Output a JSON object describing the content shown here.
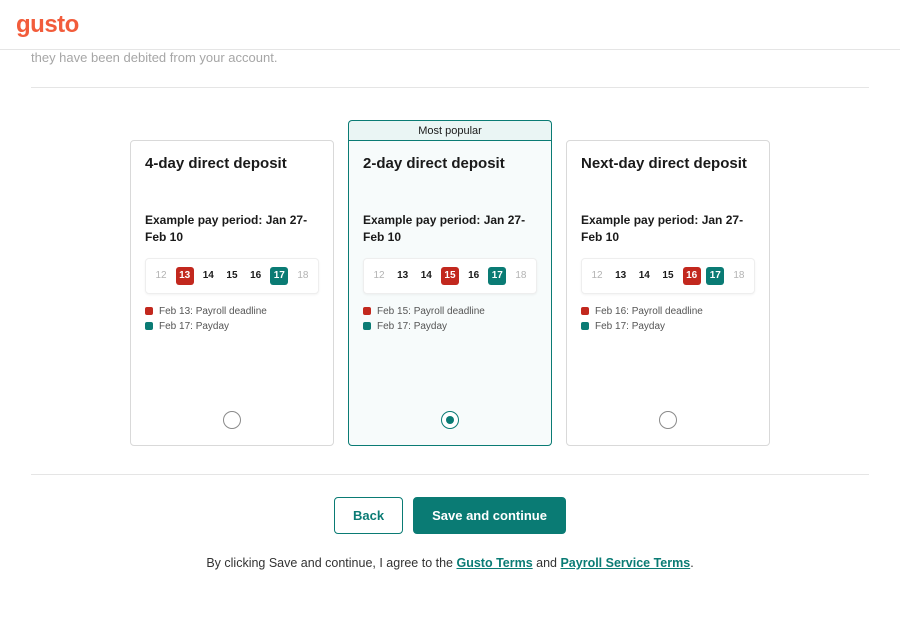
{
  "logo_text": "gusto",
  "truncated_line": "they have been debited from your account.",
  "most_popular_label": "Most popular",
  "example_label": "Example pay period: Jan 27-Feb 10",
  "days_row": [
    "12",
    "13",
    "14",
    "15",
    "16",
    "17",
    "18"
  ],
  "plans": [
    {
      "title": "4-day direct deposit",
      "deadline_day": "13",
      "payday_day": "17",
      "legend_deadline": "Feb 13: Payroll deadline",
      "legend_payday": "Feb 17: Payday",
      "selected": false
    },
    {
      "title": "2-day direct deposit",
      "deadline_day": "15",
      "payday_day": "17",
      "legend_deadline": "Feb 15: Payroll deadline",
      "legend_payday": "Feb 17: Payday",
      "selected": true
    },
    {
      "title": "Next-day direct deposit",
      "deadline_day": "16",
      "payday_day": "17",
      "legend_deadline": "Feb 16: Payroll deadline",
      "legend_payday": "Feb 17: Payday",
      "selected": false
    }
  ],
  "buttons": {
    "back": "Back",
    "save": "Save and continue"
  },
  "terms": {
    "prefix": "By clicking Save and continue, I agree to the ",
    "link1": "Gusto Terms",
    "mid": " and ",
    "link2": "Payroll Service Terms",
    "suffix": "."
  }
}
